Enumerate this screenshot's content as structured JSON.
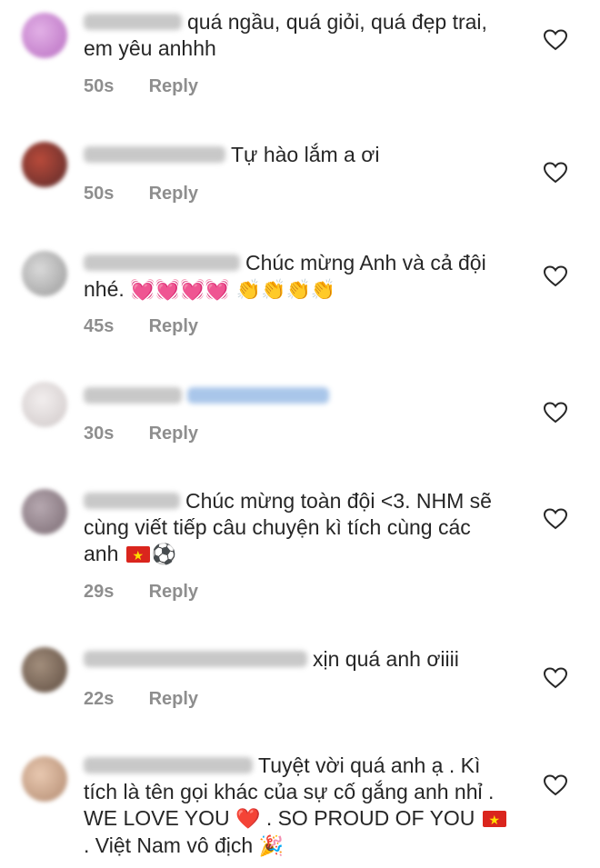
{
  "comments": [
    {
      "text": "quá ngầu, quá giỏi, quá đẹp trai, em yêu anhhh",
      "time": "50s",
      "reply": "Reply",
      "avatar_color": "#c88ccf"
    },
    {
      "text": "Tự hào lắm a ơi",
      "time": "50s",
      "reply": "Reply",
      "avatar_color": "#6b3b3b"
    },
    {
      "text": "Chúc mừng Anh và cả đội nhé.",
      "emoji": "💓💓💓💓 👏👏👏👏",
      "time": "45s",
      "reply": "Reply",
      "avatar_color": "#bdbdbd"
    },
    {
      "text": "",
      "time": "30s",
      "reply": "Reply",
      "avatar_color": "#e5e5e5"
    },
    {
      "text": "Chúc mừng toàn đội <3. NHM sẽ cùng viết tiếp câu chuyện kì tích cùng các anh",
      "emoji": "⚽",
      "time": "29s",
      "reply": "Reply",
      "avatar_color": "#9c8f96"
    },
    {
      "text": "xịn quá anh ơiiii",
      "time": "22s",
      "reply": "Reply",
      "avatar_color": "#8a7a6a"
    },
    {
      "text_a": "Tuyệt vời quá anh ạ . Kì tích là tên gọi khác của sự cố gắng anh nhỉ . WE LOVE YOU",
      "heart": "❤️",
      "text_b": ". SO PROUD OF YOU",
      "text_c": ". Việt Nam vô địch",
      "emoji": "🎉",
      "avatar_color": "#d6b39a"
    }
  ],
  "colors": {
    "text": "#262626",
    "meta": "#8e8e8e",
    "flag_red": "#da251d",
    "flag_star": "#ffde00"
  },
  "icons": {
    "like": "heart-outline-icon"
  }
}
